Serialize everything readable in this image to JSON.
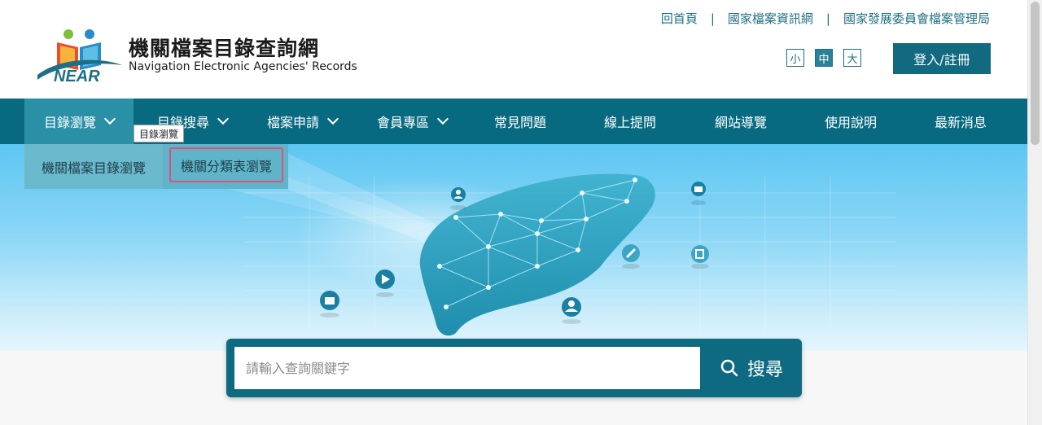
{
  "site": {
    "title": "機關檔案目錄查詢網",
    "subtitle": "Navigation Electronic Agencies' Records",
    "logo_text": "NEAR"
  },
  "top_links": [
    "回首頁",
    "國家檔案資訊網",
    "國家發展委員會檔案管理局"
  ],
  "font_size": {
    "small": "小",
    "medium": "中",
    "large": "大",
    "selected": "中"
  },
  "login_label": "登入/註冊",
  "nav": {
    "items": [
      {
        "label": "目錄瀏覽",
        "has_dropdown": true
      },
      {
        "label": "目錄搜尋",
        "has_dropdown": true
      },
      {
        "label": "檔案申請",
        "has_dropdown": true
      },
      {
        "label": "會員專區",
        "has_dropdown": true
      },
      {
        "label": "常見問題",
        "has_dropdown": false
      },
      {
        "label": "線上提問",
        "has_dropdown": false
      },
      {
        "label": "網站導覽",
        "has_dropdown": false
      },
      {
        "label": "使用說明",
        "has_dropdown": false
      },
      {
        "label": "最新消息",
        "has_dropdown": false
      }
    ],
    "tooltip": "目錄瀏覽"
  },
  "dropdown": {
    "items": [
      "機關檔案目錄瀏覽",
      "機關分類表瀏覽"
    ]
  },
  "search": {
    "placeholder": "請輸入查詢關鍵字",
    "button_label": "搜尋",
    "icon": "search-icon"
  },
  "hero_icons": [
    "user-icon",
    "folder-icon",
    "play-icon",
    "folder-icon",
    "user-icon",
    "link-icon",
    "copy-icon"
  ],
  "colors": {
    "primary": "#086a80",
    "nav_active": "#2990a6",
    "dropdown_bg": "#5fb4c9",
    "highlight_border": "#e0507a",
    "link": "#1d6f85"
  }
}
